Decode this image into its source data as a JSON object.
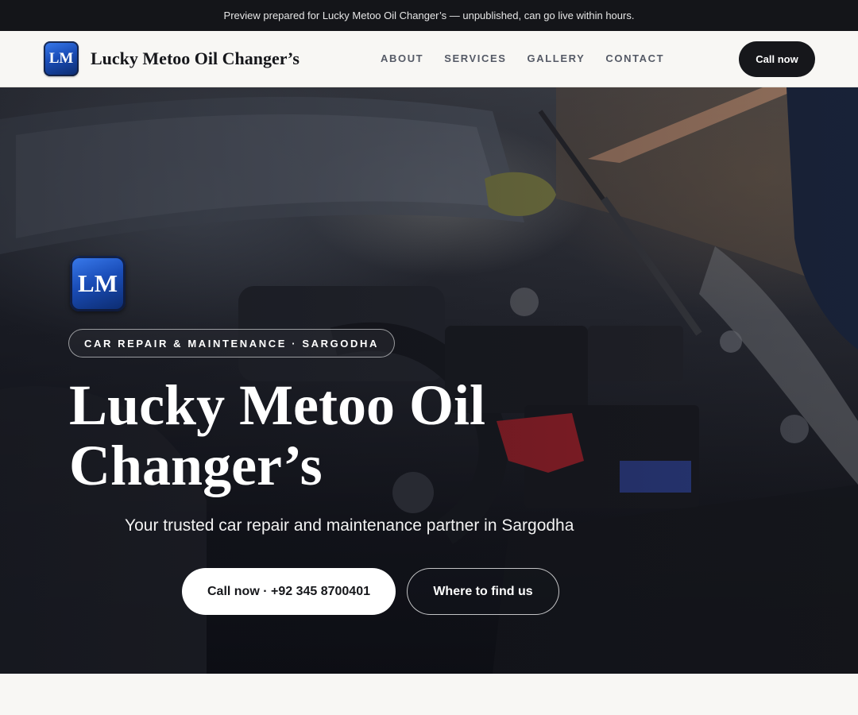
{
  "banner": {
    "text": "Preview prepared for Lucky Metoo Oil Changer’s — unpublished, can go live within hours."
  },
  "header": {
    "logo_text": "LM",
    "brand_name": "Lucky Metoo Oil Changer’s",
    "nav": [
      "ABOUT",
      "SERVICES",
      "GALLERY",
      "CONTACT"
    ],
    "cta_label": "Call now"
  },
  "hero": {
    "logo_text": "LM",
    "tag": "CAR REPAIR & MAINTENANCE · SARGODHA",
    "title": "Lucky Metoo Oil Changer’s",
    "subtitle": "Your trusted car repair and maintenance partner in Sargodha",
    "primary_button": "Call now · +92 345 8700401",
    "secondary_button": "Where to find us",
    "background_image": "car-engine-bay-photo"
  },
  "colors": {
    "dark": "#16171b",
    "logo_blue": "#1a4db8",
    "page_bg": "#f8f7f4"
  }
}
